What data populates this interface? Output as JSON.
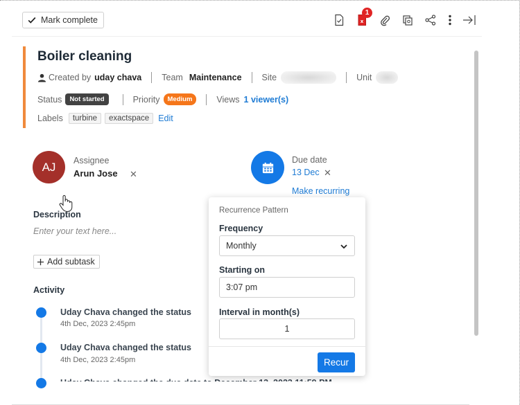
{
  "toolbar": {
    "mark_complete_label": "Mark complete",
    "attachment_badge": "1",
    "icons": [
      "document-check-icon",
      "pdf-alert-icon",
      "paperclip-icon",
      "copy-icon",
      "share-icon",
      "more-vertical-icon",
      "close-panel-icon"
    ]
  },
  "task": {
    "title": "Boiler cleaning",
    "created_by_prefix": "Created by",
    "created_by_name": "uday chava",
    "team_label": "Team",
    "team_value": "Maintenance",
    "site_label": "Site",
    "unit_label": "Unit",
    "status_label": "Status",
    "status_value": "Not started",
    "priority_label": "Priority",
    "priority_value": "Medium",
    "views_label": "Views",
    "views_value": "1 viewer(s)",
    "labels_label": "Labels",
    "labels": [
      "turbine",
      "exactspace"
    ],
    "edit_label": "Edit"
  },
  "assignee": {
    "initials": "AJ",
    "label": "Assignee",
    "name": "Arun Jose",
    "remove_symbol": "✕"
  },
  "due": {
    "label": "Due date",
    "value": "13 Dec",
    "remove_symbol": "✕",
    "make_recurring": "Make recurring"
  },
  "description": {
    "title": "Description",
    "placeholder": "Enter your text here...",
    "add_subtask": "Add subtask"
  },
  "activity": {
    "title": "Activity",
    "items": [
      {
        "text": "Uday Chava changed the status",
        "time": "4th Dec, 2023 2:45pm"
      },
      {
        "text": "Uday Chava changed the status",
        "time": "4th Dec, 2023 2:45pm"
      }
    ],
    "partial_text": "Uday Chava changed the due date to December 13, 2023 11:59 PM"
  },
  "recurrence": {
    "title": "Recurrence Pattern",
    "frequency_label": "Frequency",
    "frequency_value": "Monthly",
    "starting_label": "Starting on",
    "starting_value": "3:07 pm",
    "interval_label": "Interval in month(s)",
    "interval_value": "1",
    "recur_button": "Recur"
  },
  "colors": {
    "accent_blue": "#1479e6",
    "priority_orange": "#f5761a",
    "status_dark": "#424242",
    "avatar_red": "#a4302a",
    "title_bar_orange": "#f08a3c"
  }
}
